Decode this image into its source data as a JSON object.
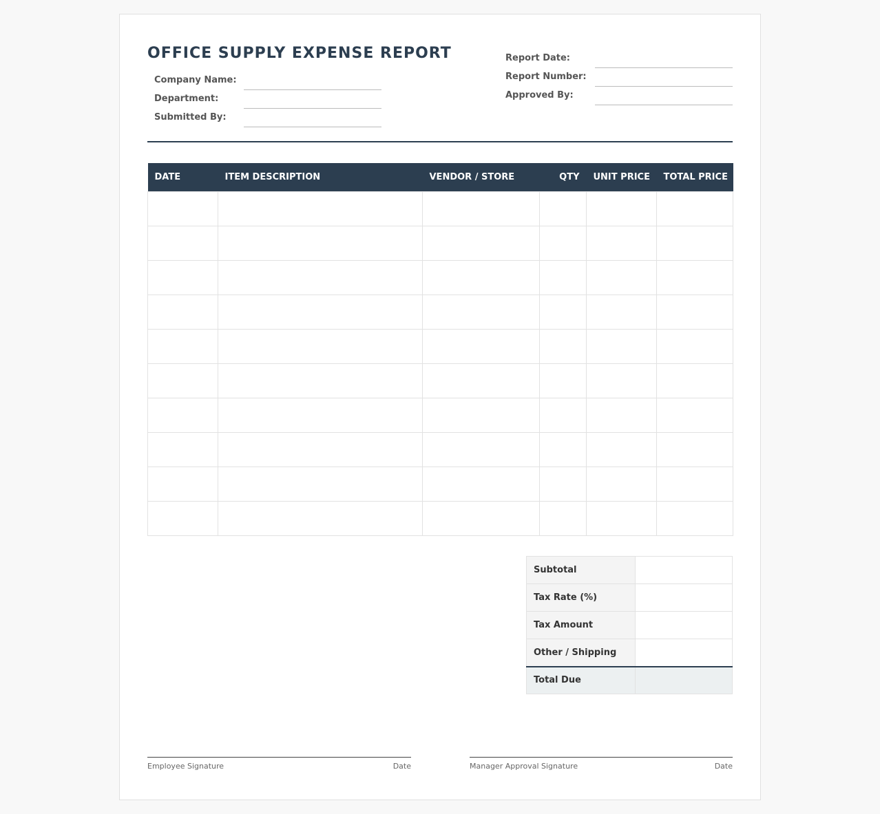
{
  "title": "OFFICE SUPPLY EXPENSE REPORT",
  "left_fields": [
    {
      "label": "Company Name:",
      "value": ""
    },
    {
      "label": "Department:",
      "value": ""
    },
    {
      "label": "Submitted By:",
      "value": ""
    }
  ],
  "right_fields": [
    {
      "label": "Report Date:",
      "value": ""
    },
    {
      "label": "Report Number:",
      "value": ""
    },
    {
      "label": "Approved By:",
      "value": ""
    }
  ],
  "table": {
    "columns": [
      "DATE",
      "ITEM DESCRIPTION",
      "VENDOR / STORE",
      "QTY",
      "UNIT PRICE",
      "TOTAL PRICE"
    ],
    "row_count": 10
  },
  "totals": [
    {
      "label": "Subtotal",
      "value": ""
    },
    {
      "label": "Tax Rate (%)",
      "value": ""
    },
    {
      "label": "Tax Amount",
      "value": ""
    },
    {
      "label": "Other / Shipping",
      "value": ""
    },
    {
      "label": "Total Due",
      "value": ""
    }
  ],
  "signatures": {
    "employee": {
      "label": "Employee Signature",
      "date_label": "Date"
    },
    "manager": {
      "label": "Manager Approval Signature",
      "date_label": "Date"
    }
  },
  "colors": {
    "header_bg": "#2c3e50",
    "header_text": "#ffffff",
    "page_bg": "#f8f8f8"
  }
}
